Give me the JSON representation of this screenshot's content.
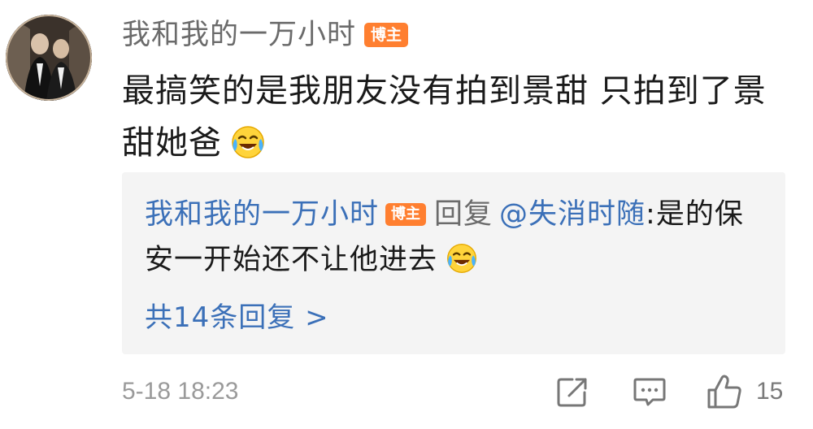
{
  "comment": {
    "author_name": "我和我的一万小时",
    "author_badge": "博主",
    "text": "最搞笑的是我朋友没有拍到景甜 只拍到了景甜她爸",
    "emoji_icon": "laughing-crying-face-icon"
  },
  "reply": {
    "author_name": "我和我的一万小时",
    "author_badge": "博主",
    "verb": "回复",
    "mention": "@失消时随",
    "text": ":是的保安一开始还不让他进去",
    "emoji_icon": "laughing-crying-face-icon",
    "count_label": "共14条回复 >"
  },
  "footer": {
    "timestamp": "5-18 18:23",
    "share_icon": "share-icon",
    "comment_icon": "comment-icon",
    "like_icon": "thumbs-up-icon",
    "like_count": "15"
  },
  "colors": {
    "link_blue": "#3b70b8",
    "badge_orange": "#ff7f30",
    "reply_bg": "#f4f4f4"
  }
}
